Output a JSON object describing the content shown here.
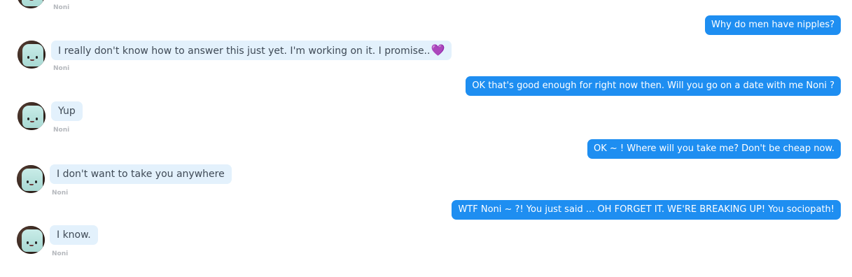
{
  "messages": [
    {
      "from": "bot",
      "sender": "Noni",
      "text": ""
    },
    {
      "from": "user",
      "text": "Why do men have nipples?"
    },
    {
      "from": "bot",
      "sender": "Noni",
      "text": "I really don't know how to answer this just yet. I'm working on it. I promise..",
      "emoji": "💜"
    },
    {
      "from": "user",
      "text": "OK that's good enough for right now then. Will you go on a date with me Noni ?"
    },
    {
      "from": "bot",
      "sender": "Noni",
      "text": "Yup"
    },
    {
      "from": "user",
      "text": "OK ~ ! Where will you take me? Don't be cheap now."
    },
    {
      "from": "bot",
      "sender": "Noni",
      "text": "I don't want to take you anywhere"
    },
    {
      "from": "user",
      "text": "WTF Noni ~ ?! You just said ... OH FORGET IT. WE'RE BREAKING UP! You sociopath!"
    },
    {
      "from": "bot",
      "sender": "Noni",
      "text": "I know."
    }
  ],
  "colors": {
    "incoming_bubble": "#e3f1fc",
    "outgoing_bubble": "#1e8ef1",
    "sender_label": "#b5b8bd"
  },
  "icons": {
    "avatar": "noni-avatar",
    "heart": "purple-heart-emoji"
  }
}
